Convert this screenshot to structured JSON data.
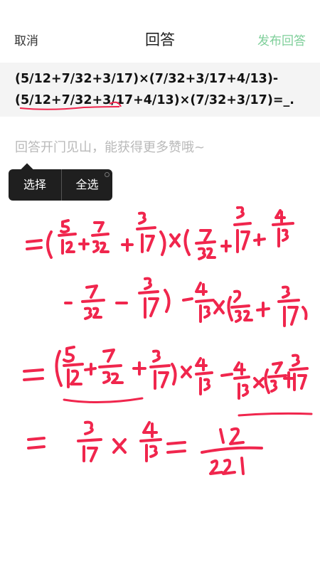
{
  "header": {
    "cancel_label": "取消",
    "title": "回答",
    "publish_label": "发布回答",
    "publish_color": "#7fcf9a"
  },
  "question": {
    "line1": "(5/12+7/32+3/17)×(7/32+3/17+4/13)-",
    "line2": "(5/12+7/32+3/17+4/13)×(7/32+3/17)=_."
  },
  "answer_input": {
    "placeholder": "回答开门见山，能获得更多赞哦~"
  },
  "selection_popup": {
    "select_label": "选择",
    "select_all_label": "全选"
  },
  "handwriting": {
    "ink_color": "#f0264d",
    "description": "handwritten solution",
    "line1": "=(5/12+7/32+3/17)×(7/32+3/17+4/13)",
    "line2": "-7/32-3/17)-4/13×(7/32+3/17)",
    "line3": "=(5/12+7/32+3/17)×4/13-4/13×(7/32+3/17)",
    "line4": "=3/17×4/13=12/221"
  }
}
